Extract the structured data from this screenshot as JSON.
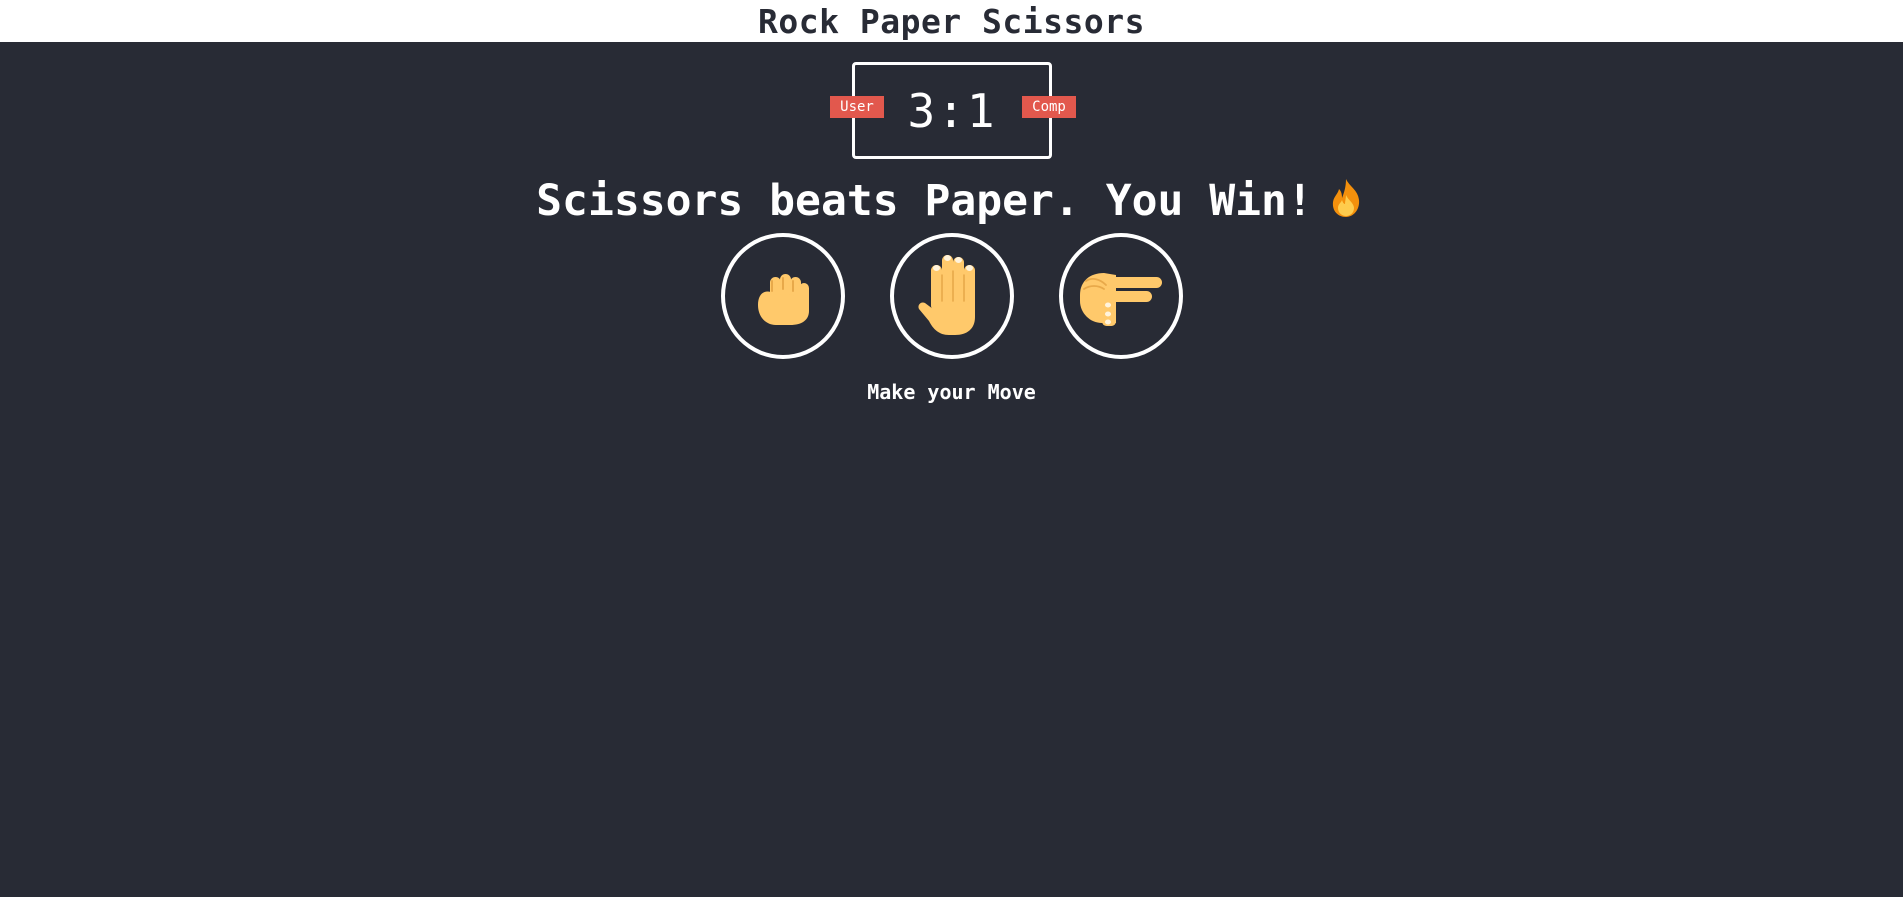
{
  "header": {
    "title": "Rock Paper Scissors"
  },
  "scoreboard": {
    "user_label": "User",
    "comp_label": "Comp",
    "score_text": "3:1"
  },
  "result": {
    "text": "Scissors beats Paper. You Win!",
    "icon": "fire-icon"
  },
  "choices": [
    {
      "id": "r",
      "icon": "rock-fist-icon"
    },
    {
      "id": "p",
      "icon": "paper-hand-icon"
    },
    {
      "id": "s",
      "icon": "scissors-hand-icon"
    }
  ],
  "message": {
    "text": "Make your Move"
  },
  "colors": {
    "background": "#282b35",
    "header_bg": "#ffffff",
    "badge_red": "#e2584d",
    "skin": "#ffc96b"
  }
}
